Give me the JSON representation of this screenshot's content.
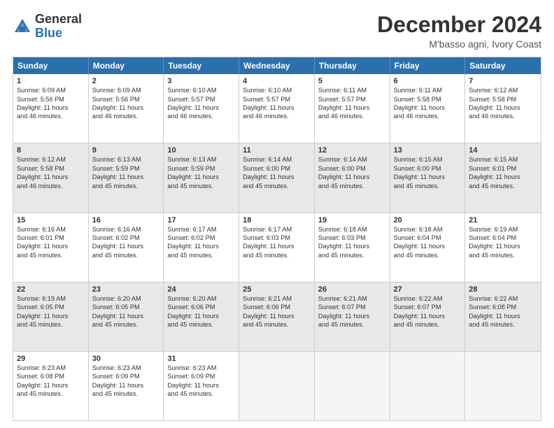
{
  "logo": {
    "general": "General",
    "blue": "Blue"
  },
  "header": {
    "month": "December 2024",
    "location": "M'basso agni, Ivory Coast"
  },
  "weekdays": [
    "Sunday",
    "Monday",
    "Tuesday",
    "Wednesday",
    "Thursday",
    "Friday",
    "Saturday"
  ],
  "rows": [
    [
      {
        "day": "1",
        "lines": [
          "Sunrise: 6:09 AM",
          "Sunset: 5:56 PM",
          "Daylight: 11 hours",
          "and 46 minutes."
        ]
      },
      {
        "day": "2",
        "lines": [
          "Sunrise: 6:09 AM",
          "Sunset: 5:56 PM",
          "Daylight: 11 hours",
          "and 46 minutes."
        ]
      },
      {
        "day": "3",
        "lines": [
          "Sunrise: 6:10 AM",
          "Sunset: 5:57 PM",
          "Daylight: 11 hours",
          "and 46 minutes."
        ]
      },
      {
        "day": "4",
        "lines": [
          "Sunrise: 6:10 AM",
          "Sunset: 5:57 PM",
          "Daylight: 11 hours",
          "and 46 minutes."
        ]
      },
      {
        "day": "5",
        "lines": [
          "Sunrise: 6:11 AM",
          "Sunset: 5:57 PM",
          "Daylight: 11 hours",
          "and 46 minutes."
        ]
      },
      {
        "day": "6",
        "lines": [
          "Sunrise: 6:11 AM",
          "Sunset: 5:58 PM",
          "Daylight: 11 hours",
          "and 46 minutes."
        ]
      },
      {
        "day": "7",
        "lines": [
          "Sunrise: 6:12 AM",
          "Sunset: 5:58 PM",
          "Daylight: 11 hours",
          "and 46 minutes."
        ]
      }
    ],
    [
      {
        "day": "8",
        "lines": [
          "Sunrise: 6:12 AM",
          "Sunset: 5:58 PM",
          "Daylight: 11 hours",
          "and 46 minutes."
        ]
      },
      {
        "day": "9",
        "lines": [
          "Sunrise: 6:13 AM",
          "Sunset: 5:59 PM",
          "Daylight: 11 hours",
          "and 45 minutes."
        ]
      },
      {
        "day": "10",
        "lines": [
          "Sunrise: 6:13 AM",
          "Sunset: 5:59 PM",
          "Daylight: 11 hours",
          "and 45 minutes."
        ]
      },
      {
        "day": "11",
        "lines": [
          "Sunrise: 6:14 AM",
          "Sunset: 6:00 PM",
          "Daylight: 11 hours",
          "and 45 minutes."
        ]
      },
      {
        "day": "12",
        "lines": [
          "Sunrise: 6:14 AM",
          "Sunset: 6:00 PM",
          "Daylight: 11 hours",
          "and 45 minutes."
        ]
      },
      {
        "day": "13",
        "lines": [
          "Sunrise: 6:15 AM",
          "Sunset: 6:00 PM",
          "Daylight: 11 hours",
          "and 45 minutes."
        ]
      },
      {
        "day": "14",
        "lines": [
          "Sunrise: 6:15 AM",
          "Sunset: 6:01 PM",
          "Daylight: 11 hours",
          "and 45 minutes."
        ]
      }
    ],
    [
      {
        "day": "15",
        "lines": [
          "Sunrise: 6:16 AM",
          "Sunset: 6:01 PM",
          "Daylight: 11 hours",
          "and 45 minutes."
        ]
      },
      {
        "day": "16",
        "lines": [
          "Sunrise: 6:16 AM",
          "Sunset: 6:02 PM",
          "Daylight: 11 hours",
          "and 45 minutes."
        ]
      },
      {
        "day": "17",
        "lines": [
          "Sunrise: 6:17 AM",
          "Sunset: 6:02 PM",
          "Daylight: 11 hours",
          "and 45 minutes."
        ]
      },
      {
        "day": "18",
        "lines": [
          "Sunrise: 6:17 AM",
          "Sunset: 6:03 PM",
          "Daylight: 11 hours",
          "and 45 minutes."
        ]
      },
      {
        "day": "19",
        "lines": [
          "Sunrise: 6:18 AM",
          "Sunset: 6:03 PM",
          "Daylight: 11 hours",
          "and 45 minutes."
        ]
      },
      {
        "day": "20",
        "lines": [
          "Sunrise: 6:18 AM",
          "Sunset: 6:04 PM",
          "Daylight: 11 hours",
          "and 45 minutes."
        ]
      },
      {
        "day": "21",
        "lines": [
          "Sunrise: 6:19 AM",
          "Sunset: 6:04 PM",
          "Daylight: 11 hours",
          "and 45 minutes."
        ]
      }
    ],
    [
      {
        "day": "22",
        "lines": [
          "Sunrise: 6:19 AM",
          "Sunset: 6:05 PM",
          "Daylight: 11 hours",
          "and 45 minutes."
        ]
      },
      {
        "day": "23",
        "lines": [
          "Sunrise: 6:20 AM",
          "Sunset: 6:05 PM",
          "Daylight: 11 hours",
          "and 45 minutes."
        ]
      },
      {
        "day": "24",
        "lines": [
          "Sunrise: 6:20 AM",
          "Sunset: 6:06 PM",
          "Daylight: 11 hours",
          "and 45 minutes."
        ]
      },
      {
        "day": "25",
        "lines": [
          "Sunrise: 6:21 AM",
          "Sunset: 6:06 PM",
          "Daylight: 11 hours",
          "and 45 minutes."
        ]
      },
      {
        "day": "26",
        "lines": [
          "Sunrise: 6:21 AM",
          "Sunset: 6:07 PM",
          "Daylight: 11 hours",
          "and 45 minutes."
        ]
      },
      {
        "day": "27",
        "lines": [
          "Sunrise: 6:22 AM",
          "Sunset: 6:07 PM",
          "Daylight: 11 hours",
          "and 45 minutes."
        ]
      },
      {
        "day": "28",
        "lines": [
          "Sunrise: 6:22 AM",
          "Sunset: 6:08 PM",
          "Daylight: 11 hours",
          "and 45 minutes."
        ]
      }
    ],
    [
      {
        "day": "29",
        "lines": [
          "Sunrise: 6:23 AM",
          "Sunset: 6:08 PM",
          "Daylight: 11 hours",
          "and 45 minutes."
        ]
      },
      {
        "day": "30",
        "lines": [
          "Sunrise: 6:23 AM",
          "Sunset: 6:09 PM",
          "Daylight: 11 hours",
          "and 45 minutes."
        ]
      },
      {
        "day": "31",
        "lines": [
          "Sunrise: 6:23 AM",
          "Sunset: 6:09 PM",
          "Daylight: 11 hours",
          "and 45 minutes."
        ]
      },
      {
        "day": "",
        "lines": []
      },
      {
        "day": "",
        "lines": []
      },
      {
        "day": "",
        "lines": []
      },
      {
        "day": "",
        "lines": []
      }
    ]
  ]
}
